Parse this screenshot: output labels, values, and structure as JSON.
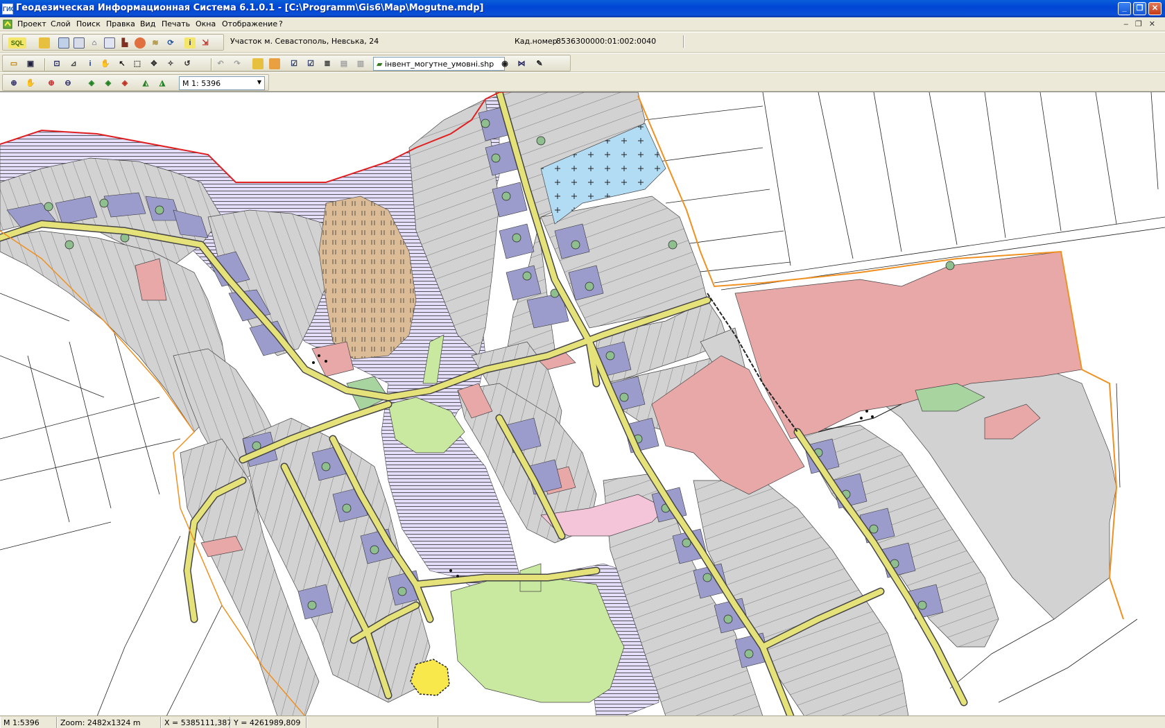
{
  "window": {
    "title": "Геодезическая Информационная Система 6.1.0.1 - [C:\\Programm\\Gis6\\Map\\Mogutne.mdp]",
    "app_icon_text": "ГИС"
  },
  "menu": {
    "items": [
      "Проект",
      "Слой",
      "Поиск",
      "Правка",
      "Вид",
      "Печать",
      "Окна",
      "Отображение",
      "?"
    ]
  },
  "toolbar_top": {
    "sql_label": "SQL",
    "parcel_field": "Участок  м. Севастополь, Невська, 24",
    "cadastral_label": "Кад.номер",
    "cadastral_value": "8536300000:01:002:0040"
  },
  "toolbar_layer": {
    "layer_name": "інвент_могутне_умовні.shp"
  },
  "toolbar_scale": {
    "scale_value": "M 1: 5396"
  },
  "status": {
    "scale": "M 1:5396",
    "zoom": "Zoom: 2482x1324 m",
    "x": "X = 5385111,387",
    "y": "Y = 4261989,809"
  },
  "icons": {
    "app": "gis-app-icon",
    "minimize": "minimize-icon",
    "maximize": "maximize-icon",
    "close": "close-icon"
  },
  "colors": {
    "title_bar": "#0a5fd8",
    "parcel_gray": "#d2d2d2",
    "road_yellow": "#e6e27a",
    "yard_blue": "#9c9ccc",
    "green_zone": "#c9e8a0",
    "lavender_zone": "#e5defa",
    "sand_zone": "#dcbc96",
    "pink_industrial": "#e8a8a8",
    "water_blue": "#b2dcf4",
    "boundary_red": "#e02020",
    "boundary_orange": "#f09020"
  }
}
